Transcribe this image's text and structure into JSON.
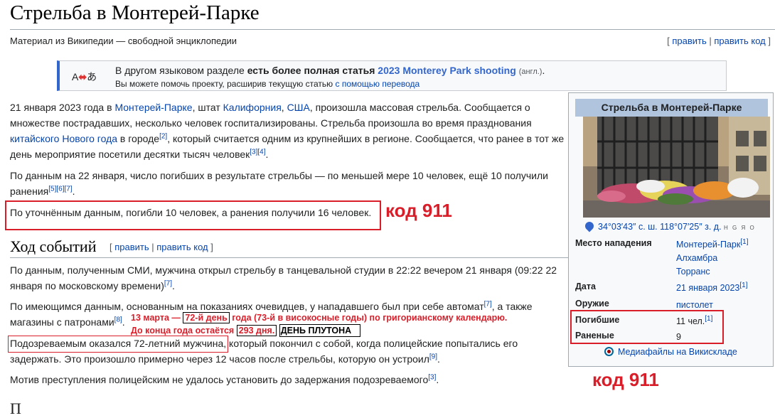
{
  "page": {
    "title": "Стрельба в Монтерей-Парке",
    "subtitle": "Материал из Википедии — свободной энциклопедии",
    "edit_open": "[ ",
    "edit": "править",
    "sep": " | ",
    "edit_code": "править код",
    "edit_close": " ]"
  },
  "lang_notice": {
    "icon_a": "A",
    "icon_arrow": "⬌",
    "icon_b": "あ",
    "text_pre": "В другом языковом разделе ",
    "text_bold": "есть более полная статья",
    "article_link": "2023 Monterey Park shooting",
    "lang": "(англ.)",
    "dot": ".",
    "help_text": "Вы можете помочь проекту, расширив текущую статью ",
    "help_link": "с помощью перевода"
  },
  "para1": {
    "t1": "21 января 2023 года в ",
    "l1": "Монтерей-Парке",
    "t2": ", штат ",
    "l2": "Калифорния",
    "t3": ", ",
    "l3": "США",
    "t4": ", произошла массовая стрельба. Сообщается о множестве пострадавших, несколько человек госпитализированы. Стрельба произошла во время празднования ",
    "l4": "китайского",
    "t5": " ",
    "l5": "Нового года",
    "t6": " в городе",
    "s1": "[2]",
    "t7": ", который считается одним из крупнейших в регионе. Сообщается, что ранее в тот же день мероприятие посетили десятки тысяч человек",
    "s2": "[3][4]",
    "t8": "."
  },
  "para2": {
    "t1": "По данным на 22 января, число погибших в результате стрельбы — по меньшей мере 10 человек, ещё 10 получили ранения",
    "s1": "[5][6][7]",
    "t2": "."
  },
  "para3": "По уточнённым данным, погибли 10 человек, а ранения получили 16 человек.",
  "annotation_code": "код 911",
  "section": {
    "title": "Ход событий",
    "edit_open": "[ ",
    "edit": "править",
    "sep": " | ",
    "edit_code": "править код",
    "edit_close": " ]"
  },
  "para4": {
    "t1": "По данным, полученным СМИ, мужчина открыл стрельбу в танцевальной студии в 22:22 вечером 21 января (09:22 22 января по московскому времени)",
    "s1": "[7]",
    "t2": "."
  },
  "para5": {
    "line1": "По имеющимся данным, основанным на показаниях очевидцев, у нападавшего был при себе автомат",
    "s1": "[7]",
    "line1b": ", а также",
    "line2": "магазины с патронами",
    "s2": "[8]",
    "t2": "."
  },
  "overlay": {
    "line1_pre": "13 марта — ",
    "line1_box": "72-й день",
    "line1_post": " года (73-й в високосные годы) по григорианскому календарю.",
    "line2_pre": "До конца года остаётся ",
    "line2_box": "293 дня.",
    "line2_bold": " ДЕНЬ ПЛУТОНА"
  },
  "para6": {
    "boxed": "Подозреваемым оказался 72-летний мужчина,",
    "t1": " который покончил с собой, когда полицейские попытались его задержать. Это произошло примерно через 12 часов после стрельбы, которую он устроил",
    "s1": "[9]",
    "t2": "."
  },
  "para7": {
    "t1": "Мотив преступления полицейским не удалось установить до задержания подозреваемого",
    "s1": "[3]",
    "t2": "."
  },
  "infobox": {
    "title": "Стрельба в Монтерей-Парке",
    "coords": "34°03′43″ с. ш. 118°07′25″ з. д.",
    "hgro": "H G Я O",
    "rows": [
      {
        "label": "Место нападения",
        "values": [
          "Монтерей-Парк",
          "Алхамбра",
          "Торранс"
        ],
        "sup": "[1]"
      },
      {
        "label": "Дата",
        "value": "21 января",
        "value2": " 2023",
        "sup": "[1]"
      },
      {
        "label": "Оружие",
        "value": "пистолет"
      },
      {
        "label": "Погибшие",
        "value": "11 чел.",
        "sup": "[1]"
      },
      {
        "label": "Раненые",
        "value": "9"
      }
    ],
    "commons": "Медиафайлы на Викискладе"
  },
  "bottom_cut": "П"
}
